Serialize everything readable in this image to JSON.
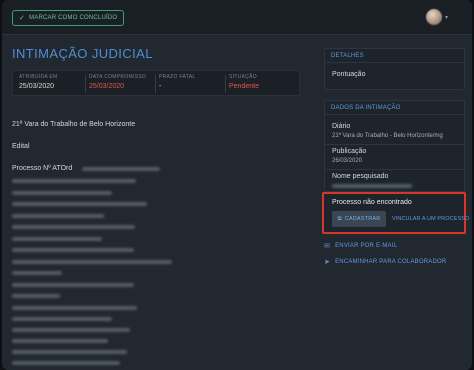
{
  "toolbar": {
    "done_label": "MARCAR COMO CONCLUÍDO",
    "check_icon": "✓"
  },
  "page": {
    "title": "INTIMAÇÃO JUDICIAL"
  },
  "meta": {
    "atribuida": {
      "label": "ATRIBUÍDA EM",
      "value": "25/03/2020"
    },
    "compromisso": {
      "label": "DATA COMPROMISSO",
      "value": "25/03/2020"
    },
    "prazo": {
      "label": "PRAZO FATAL",
      "value": "-"
    },
    "situacao": {
      "label": "SITUAÇÃO",
      "value": "Pendente"
    }
  },
  "content": {
    "vara": "21ª Vara do Trabalho de Belo Horizonte",
    "edital": "Edital",
    "processo_prefix": "Processo Nº ATOrd"
  },
  "details": {
    "header": "DETALHES",
    "pontuacao_label": "Pontuação"
  },
  "intimacao": {
    "header": "DADOS DA INTIMAÇÃO",
    "diario_label": "Diário",
    "diario_value": "21ª Vara do Trabalho - Belo Horizonte/mg",
    "publicacao_label": "Publicação",
    "publicacao_value": "26/03/2020",
    "nome_label": "Nome pesquisado"
  },
  "not_found": {
    "title": "Processo não encontrado",
    "cadastrar_label": "CADASTRAR",
    "vincular_label": "VINCULAR A UM PROCESSO"
  },
  "actions": {
    "email_label": "ENVIAR POR E-MAIL",
    "forward_label": "ENCAMINHAR PARA COLABORADOR"
  },
  "colors": {
    "accent": "#4f8ed6",
    "success": "#3aa06d",
    "danger": "#e0574c",
    "highlight": "#d8362a"
  }
}
